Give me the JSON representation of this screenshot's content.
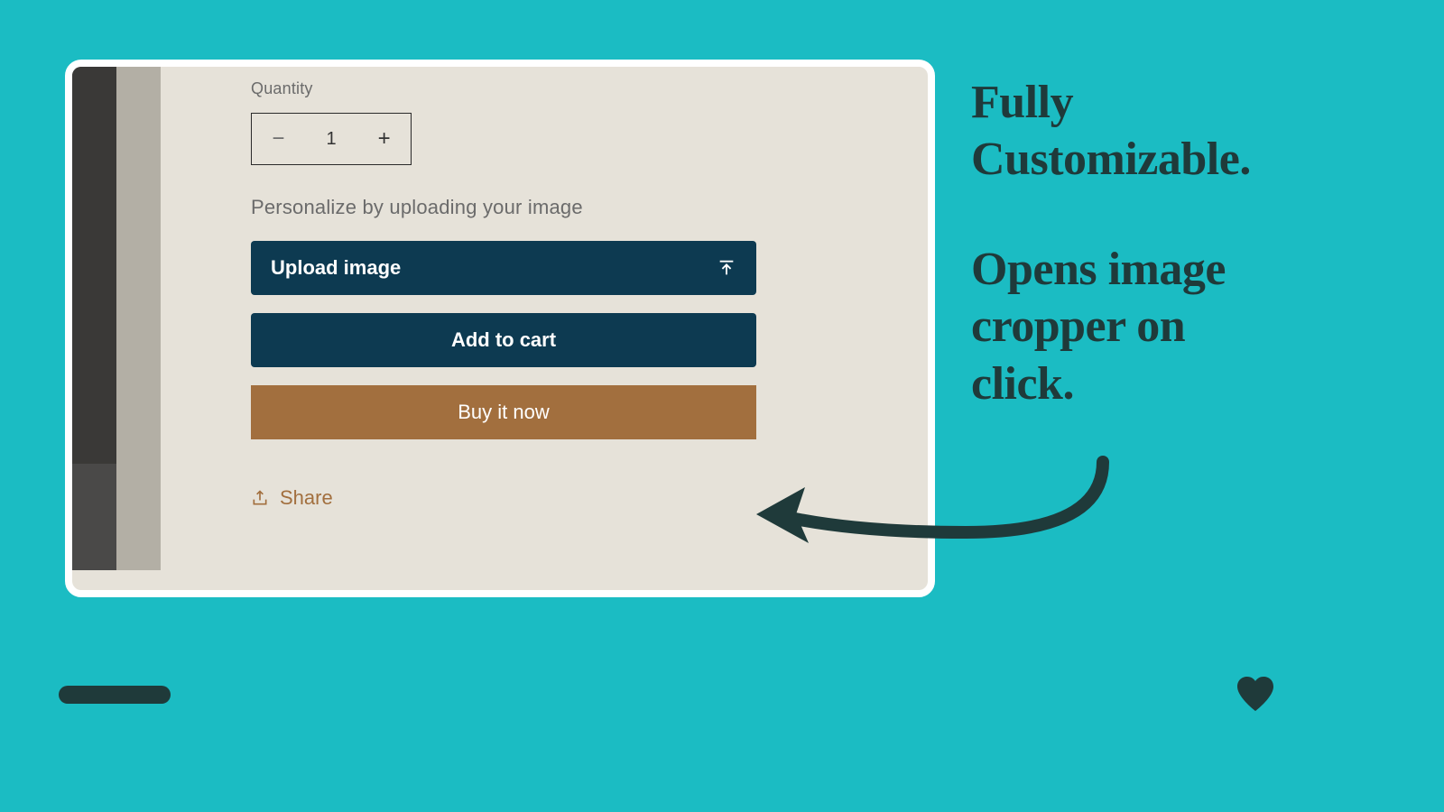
{
  "product": {
    "quantity_label": "Quantity",
    "quantity_value": "1",
    "personalize_label": "Personalize by uploading your image",
    "upload_label": "Upload image",
    "add_to_cart_label": "Add to cart",
    "buy_now_label": "Buy it now",
    "share_label": "Share"
  },
  "annotation": {
    "line1": "Fully",
    "line2": "Customizable.",
    "line3": "Opens image",
    "line4": "cropper on",
    "line5": "click."
  },
  "colors": {
    "background": "#1BBCC3",
    "card_bg": "#E6E2D9",
    "primary_button": "#0D3A51",
    "secondary_button": "#A26F3E",
    "accent_text": "#1F3A3A"
  }
}
